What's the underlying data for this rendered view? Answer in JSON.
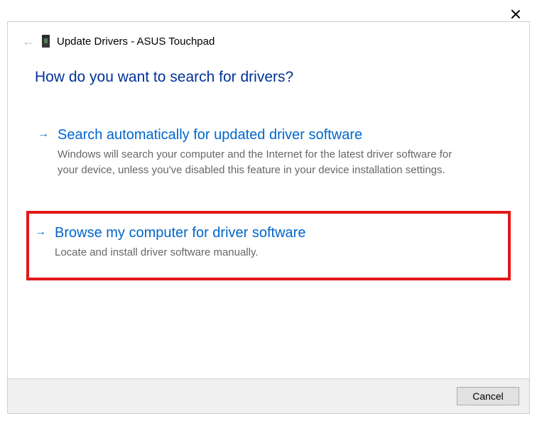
{
  "window": {
    "title_prefix": "Update Drivers",
    "device": "ASUS Touchpad",
    "full_title": "Update Drivers - ASUS Touchpad"
  },
  "heading": "How do you want to search for drivers?",
  "options": [
    {
      "title": "Search automatically for updated driver software",
      "description": "Windows will search your computer and the Internet for the latest driver software for your device, unless you've disabled this feature in your device installation settings."
    },
    {
      "title": "Browse my computer for driver software",
      "description": "Locate and install driver software manually."
    }
  ],
  "footer": {
    "cancel_label": "Cancel"
  }
}
